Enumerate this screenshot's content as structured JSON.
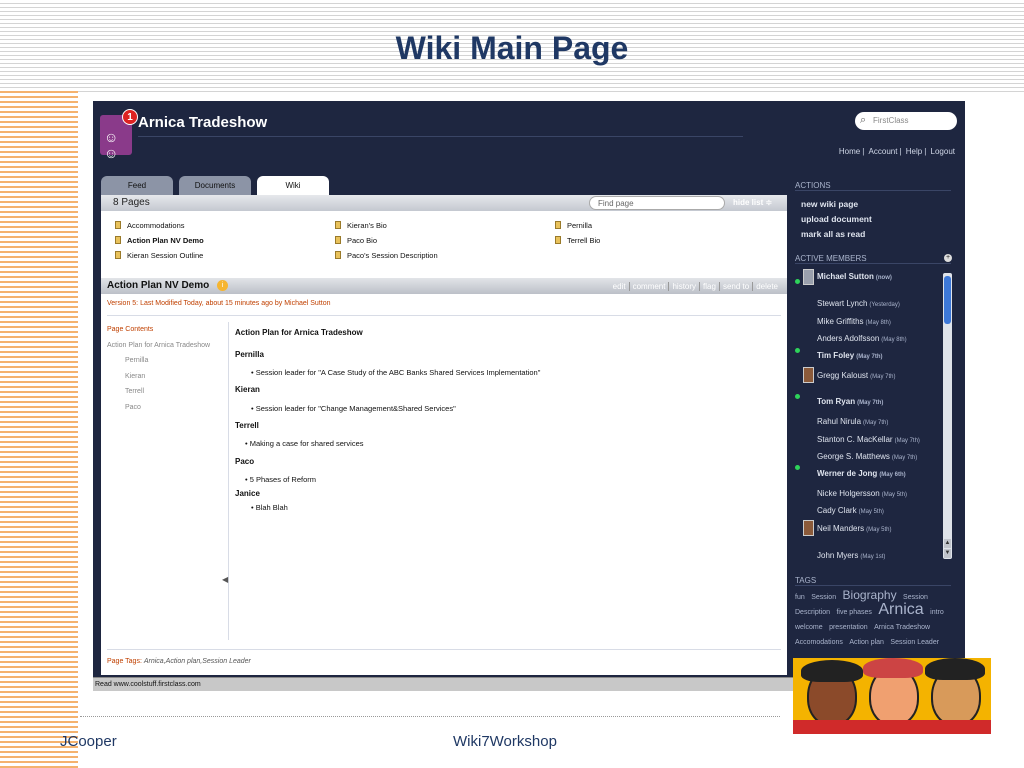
{
  "slide": {
    "title": "Wiki Main Page",
    "footer_left": "JCooper",
    "footer_center": "Wiki7Workshop"
  },
  "app": {
    "title": "Arnica Tradeshow",
    "notification_count": "1",
    "search_placeholder": "FirstClass",
    "top_links": [
      "Home",
      "Account",
      "Help",
      "Logout"
    ],
    "tabs": [
      {
        "label": "Feed",
        "active": false
      },
      {
        "label": "Documents",
        "active": false
      },
      {
        "label": "Wiki",
        "active": true
      }
    ],
    "status": "Read www.coolstuff.firstclass.com"
  },
  "wiki": {
    "page_count": "8 Pages",
    "find_placeholder": "Find page",
    "hide_list": "hide list ≑",
    "pages": [
      "Accommodations",
      "Kieran's Bio",
      "Pernilla",
      "Action Plan NV Demo",
      "Paco Bio",
      "Terrell Bio",
      "Kieran Session Outline",
      "Paco's Session Description"
    ],
    "doc_title": "Action Plan NV Demo",
    "doc_actions": [
      "edit",
      "comment",
      "history",
      "flag",
      "send to",
      "delete"
    ],
    "version": "Version 5: Last Modified Today, about 15 minutes ago by Michael Sutton",
    "contents": {
      "heading": "Page Contents",
      "top": "Action Plan for Arnica Tradeshow",
      "items": [
        "Pernilla",
        "Kieran",
        "Terrell",
        "Paco"
      ]
    },
    "body": {
      "title": "Action Plan for Arnica Tradeshow",
      "h1": "Pernilla",
      "b1": "•      Session leader for  \"A Case Study of the ABC Banks Shared Services Implementation\"",
      "h2": "Kieran",
      "b2": "•    Session leader for \"Change Management&Shared Services\"",
      "h3": "Terrell",
      "b3": "• Making a case for shared services",
      "h4": "Paco",
      "b4": "• 5 Phases of Reform",
      "h5": "Janice",
      "b5": "•      Blah Blah"
    },
    "page_tags_label": "Page Tags:",
    "page_tags": "Arnica,Action plan,Session Leader"
  },
  "sidebar": {
    "actions_title": "ACTIONS",
    "actions": [
      "new wiki page",
      "upload document",
      "mark all as read"
    ],
    "members_title": "ACTIVE MEMBERS",
    "members": [
      {
        "name": "Michael Sutton",
        "time": "(now)",
        "bold": true
      },
      {
        "name": "Stewart Lynch",
        "time": "(Yesterday)",
        "bold": false
      },
      {
        "name": "Mike Griffiths",
        "time": "(May 8th)",
        "bold": false
      },
      {
        "name": "Anders Adolfsson",
        "time": "(May 8th)",
        "bold": false
      },
      {
        "name": "Tim Foley",
        "time": "(May 7th)",
        "bold": true
      },
      {
        "name": "Gregg Kaloust",
        "time": "(May 7th)",
        "bold": false
      },
      {
        "name": "Tom Ryan",
        "time": "(May 7th)",
        "bold": true
      },
      {
        "name": "Rahul Nirula",
        "time": "(May 7th)",
        "bold": false
      },
      {
        "name": "Stanton C. MacKellar",
        "time": "(May 7th)",
        "bold": false
      },
      {
        "name": "George S. Matthews",
        "time": "(May 7th)",
        "bold": false
      },
      {
        "name": "Werner de Jong",
        "time": "(May 6th)",
        "bold": true
      },
      {
        "name": "Nicke Holgersson",
        "time": "(May 5th)",
        "bold": false
      },
      {
        "name": "Cady Clark",
        "time": "(May 5th)",
        "bold": false
      },
      {
        "name": "Neil Manders",
        "time": "(May 5th)",
        "bold": false
      },
      {
        "name": "John Myers",
        "time": "(May 1st)",
        "bold": false
      }
    ],
    "tags_title": "TAGS",
    "tags": [
      "fun",
      "Session",
      "Biography",
      "Session Description",
      "five phases",
      "Arnica",
      "intro",
      "welcome",
      "presentation",
      "Arnica Tradeshow",
      "Accomodations",
      "Action plan",
      "Session Leader"
    ]
  }
}
